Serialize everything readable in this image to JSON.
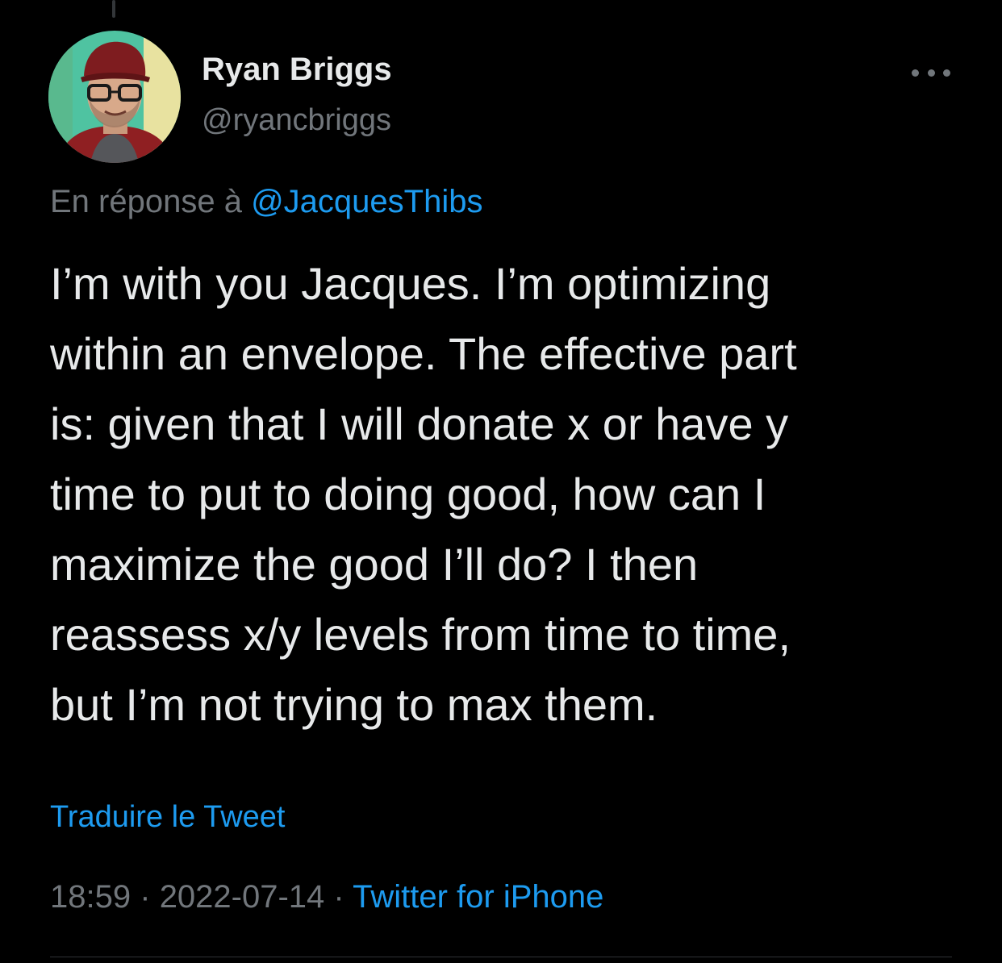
{
  "author": {
    "name": "Ryan Briggs",
    "handle": "@ryancbriggs"
  },
  "reply": {
    "prefix": "En réponse à",
    "mention": "@JacquesThibs"
  },
  "tweet": {
    "text": "I’m with you Jacques.  I’m optimizing\nwithin an envelope. The effective part\nis: given that I will donate x or have y\ntime to put to doing good, how can I\nmaximize the good I’ll do? I then\nreassess x/y levels from time to time,\nbut I’m not trying to max them."
  },
  "translate_label": "Traduire le Tweet",
  "meta": {
    "time": "18:59",
    "separator": "·",
    "date": "2022-07-14",
    "source": "Twitter for iPhone"
  },
  "icons": {
    "more": "more-horizontal-icon",
    "avatar": "profile-avatar"
  },
  "colors": {
    "background": "#000000",
    "text": "#e7e9ea",
    "secondary": "#71767b",
    "accent": "#1d9bf0"
  }
}
